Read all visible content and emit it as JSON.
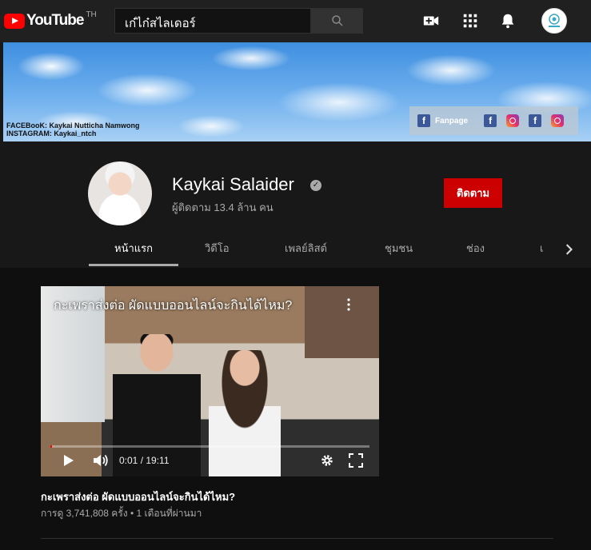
{
  "masthead": {
    "logo_text": "YouTube",
    "region": "TH",
    "search_value": "เก๋ไก๋สไลเดอร์"
  },
  "banner": {
    "line1": "FACEBooK: Kaykai Nutticha Namwong",
    "line2": "INSTAGRAM: Kaykai_ntch",
    "fanpage_label": "Fanpage"
  },
  "channel": {
    "name": "Kaykai Salaider",
    "subscribers": "ผู้ติดตาม 13.4 ล้าน คน",
    "subscribe_label": "ติดตาม"
  },
  "tabs": [
    {
      "label": "หน้าแรก",
      "active": true
    },
    {
      "label": "วิดีโอ",
      "active": false
    },
    {
      "label": "เพลย์ลิสต์",
      "active": false
    },
    {
      "label": "ชุมชน",
      "active": false
    },
    {
      "label": "ช่อง",
      "active": false
    },
    {
      "label": "เ",
      "active": false
    }
  ],
  "featured_video": {
    "overlay_title": "กะเพราส่งต่อ ผัดแบบออนไลน์จะกินได้ไหม?",
    "time": "0:01 / 19:11",
    "progress": 0.001,
    "title": "กะเพราส่งต่อ ผัดแบบออนไลน์จะกินได้ไหม?",
    "meta": "การดู 3,741,808 ครั้ง • 1 เดือนที่ผ่านมา"
  },
  "colors": {
    "accent": "#ff0000",
    "subscribe": "#cc0000",
    "background": "#181818"
  }
}
